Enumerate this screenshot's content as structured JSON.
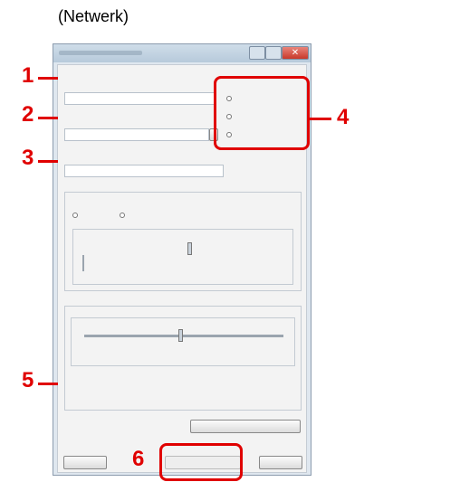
{
  "page_title": "(Netwerk)",
  "dialog": {
    "window_controls": {
      "close_glyph": "✕"
    }
  },
  "callouts": [
    "1",
    "2",
    "3",
    "4",
    "5",
    "6"
  ],
  "colors": {
    "callout_red": "#e00000",
    "dialog_frame": "#8c9cae",
    "content_bg": "#f3f3f3"
  }
}
